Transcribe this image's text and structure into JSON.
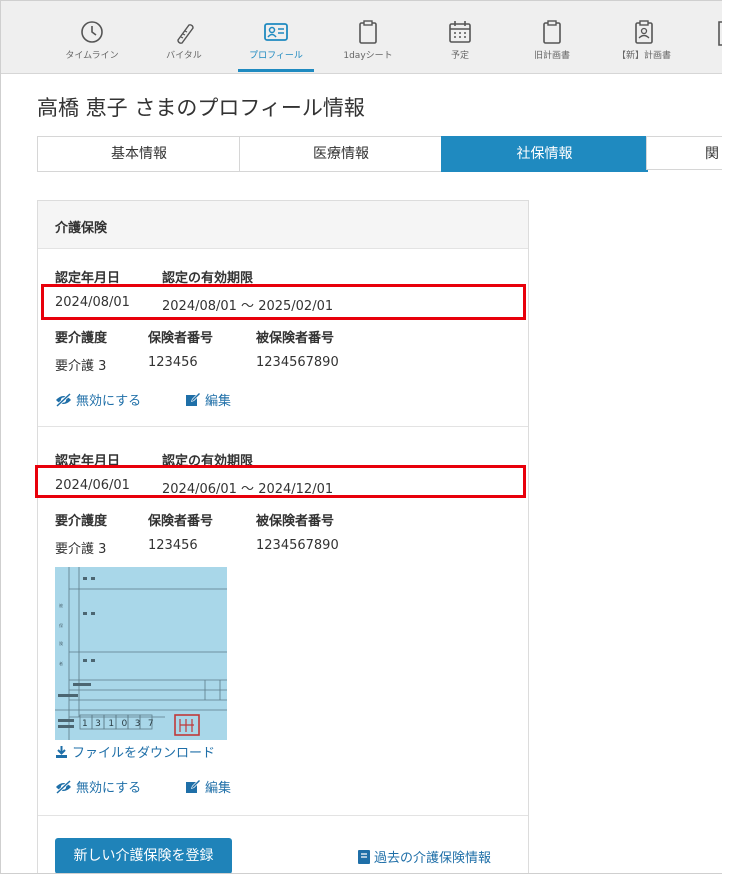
{
  "nav": {
    "items": [
      {
        "label": "タイムライン",
        "icon": "clock-icon"
      },
      {
        "label": "バイタル",
        "icon": "thermometer-icon"
      },
      {
        "label": "プロフィール",
        "icon": "profile-card-icon"
      },
      {
        "label": "1dayシート",
        "icon": "clipboard-icon"
      },
      {
        "label": "予定",
        "icon": "calendar-icon"
      },
      {
        "label": "旧計画書",
        "icon": "clipboard-icon"
      },
      {
        "label": "【新】計画書",
        "icon": "clipboard-person-icon"
      }
    ],
    "active_index": 2,
    "active_color": "#1f8ac0"
  },
  "page_title": "高橋 恵子 さまのプロフィール情報",
  "tabs": [
    {
      "label": "基本情報"
    },
    {
      "label": "医療情報"
    },
    {
      "label": "社保情報"
    },
    {
      "label": "関"
    }
  ],
  "active_tab_index": 2,
  "care": {
    "title": "介護保険",
    "labels": {
      "cert_date": "認定年月日",
      "valid_period": "認定の有効期限",
      "care_level": "要介護度",
      "insurer_no": "保険者番号",
      "insured_no": "被保険者番号"
    },
    "records": [
      {
        "cert_date": "2024/08/01",
        "valid_period": "2024/08/01 ～ 2025/02/01",
        "care_level": "要介護 3",
        "insurer_no": "123456",
        "insured_no": "1234567890"
      },
      {
        "cert_date": "2024/06/01",
        "valid_period": "2024/06/01 ～ 2024/12/01",
        "care_level": "要介護 3",
        "insurer_no": "123456",
        "insured_no": "1234567890"
      }
    ],
    "disable_label": "無効にする",
    "edit_label": "編集",
    "download_label": "ファイルをダウンロード",
    "scan_number": "1 3 1 0 3 7",
    "register_button": "新しい介護保険を登録",
    "history_link": "過去の介護保険情報"
  },
  "colors": {
    "accent": "#1f8ac0",
    "highlight": "#e8000b",
    "link": "#1f6fa8"
  }
}
